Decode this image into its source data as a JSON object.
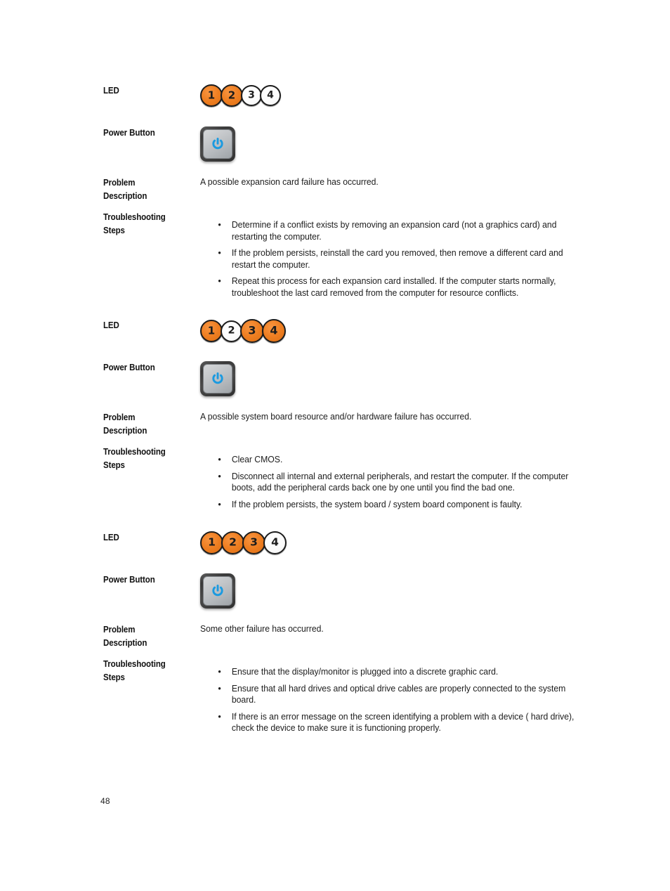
{
  "page": {
    "number": "48",
    "background_color": "#ffffff"
  },
  "colors": {
    "led_on": "#ef7f22",
    "led_off": "#ffffff",
    "led_ring": "#1c1c1c",
    "power_glyph": "#1b9ae0",
    "text": "#1d1d1d"
  },
  "labels": {
    "led": "LED",
    "power_button": "Power Button",
    "problem_description_line1": "Problem",
    "problem_description_line2": "Description",
    "troubleshooting_line1": "Troubleshooting",
    "troubleshooting_line2": "Steps"
  },
  "sections": [
    {
      "led": {
        "icon_name": "diagnostic-led-strip",
        "lights": [
          {
            "number": "1",
            "state": "on"
          },
          {
            "number": "2",
            "state": "on"
          },
          {
            "number": "3",
            "state": "off"
          },
          {
            "number": "4",
            "state": "off"
          }
        ]
      },
      "power_button": {
        "icon_name": "power-button-icon",
        "state": "solid-blue"
      },
      "problem_description": "A possible expansion card failure has occurred.",
      "troubleshooting_steps": [
        "Determine if a conflict exists by removing an expansion card (not a graphics card) and restarting the computer.",
        "If the problem persists, reinstall the card you removed, then remove a different card and restart the computer.",
        "Repeat this process for each expansion card installed. If the computer starts normally, troubleshoot the last card removed from the computer for resource conflicts."
      ]
    },
    {
      "led": {
        "icon_name": "diagnostic-led-strip",
        "lights": [
          {
            "number": "1",
            "state": "on"
          },
          {
            "number": "2",
            "state": "off"
          },
          {
            "number": "3",
            "state": "on"
          },
          {
            "number": "4",
            "state": "on"
          }
        ]
      },
      "power_button": {
        "icon_name": "power-button-icon",
        "state": "solid-blue"
      },
      "problem_description": "A possible system board resource and/or hardware failure has occurred.",
      "troubleshooting_steps": [
        "Clear CMOS.",
        "Disconnect all internal and external peripherals, and restart the computer. If the computer boots, add the peripheral cards back one by one until you find the bad one.",
        "If the problem persists, the system board / system board component is faulty."
      ]
    },
    {
      "led": {
        "icon_name": "diagnostic-led-strip",
        "lights": [
          {
            "number": "1",
            "state": "on"
          },
          {
            "number": "2",
            "state": "on"
          },
          {
            "number": "3",
            "state": "on"
          },
          {
            "number": "4",
            "state": "off"
          }
        ]
      },
      "power_button": {
        "icon_name": "power-button-icon",
        "state": "solid-blue"
      },
      "problem_description": "Some other failure has occurred.",
      "troubleshooting_steps": [
        "Ensure that the display/monitor is plugged into a discrete graphic card.",
        "Ensure that all hard drives and optical drive cables are properly connected to the system board.",
        "If there is an error message on the screen identifying a problem with a device ( hard drive), check the device to make sure it is functioning properly."
      ]
    }
  ]
}
